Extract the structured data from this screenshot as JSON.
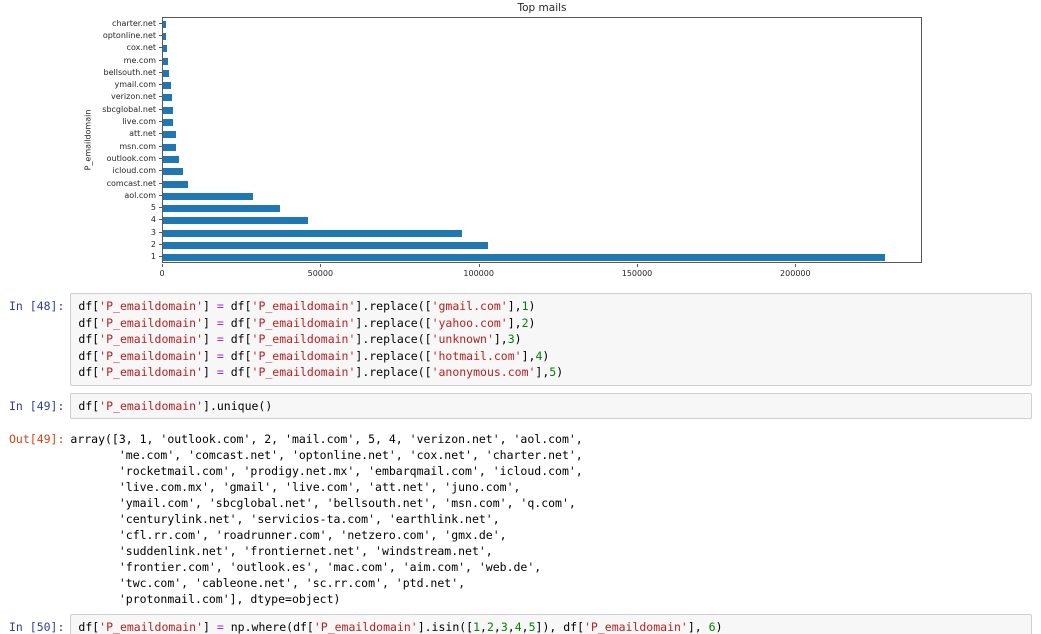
{
  "chart_data": {
    "type": "bar",
    "orientation": "horizontal",
    "title": "Top mails",
    "ylabel": "P_emaildomain",
    "xlabel": "",
    "categories": [
      "charter.net",
      "optonline.net",
      "cox.net",
      "me.com",
      "bellsouth.net",
      "ymail.com",
      "verizon.net",
      "sbcglobal.net",
      "live.com",
      "att.net",
      "msn.com",
      "outlook.com",
      "icloud.com",
      "comcast.net",
      "aol.com",
      "5",
      "4",
      "3",
      "2",
      "1"
    ],
    "values": [
      800,
      950,
      1400,
      1550,
      1900,
      2400,
      2700,
      3000,
      3050,
      4000,
      4100,
      5100,
      6300,
      7900,
      28300,
      37000,
      45700,
      94500,
      102500,
      228000
    ],
    "xlim": [
      0,
      240000
    ],
    "xticks": [
      0,
      50000,
      100000,
      150000,
      200000
    ],
    "bar_color": "#1f77b4",
    "grid": false,
    "legend": null
  },
  "notebook": {
    "cells": [
      {
        "kind": "code-input",
        "prompt": "In [48]:",
        "code_lines": [
          "df['P_emaildomain'] = df['P_emaildomain'].replace(['gmail.com'],1)",
          "df['P_emaildomain'] = df['P_emaildomain'].replace(['yahoo.com'],2)",
          "df['P_emaildomain'] = df['P_emaildomain'].replace(['unknown'],3)",
          "df['P_emaildomain'] = df['P_emaildomain'].replace(['hotmail.com'],4)",
          "df['P_emaildomain'] = df['P_emaildomain'].replace(['anonymous.com'],5)"
        ]
      },
      {
        "kind": "code-input",
        "prompt": "In [49]:",
        "code_lines": [
          "df['P_emaildomain'].unique()"
        ]
      },
      {
        "kind": "code-output",
        "prompt": "Out[49]:",
        "text_lines": [
          "array([3, 1, 'outlook.com', 2, 'mail.com', 5, 4, 'verizon.net', 'aol.com',",
          "       'me.com', 'comcast.net', 'optonline.net', 'cox.net', 'charter.net',",
          "       'rocketmail.com', 'prodigy.net.mx', 'embarqmail.com', 'icloud.com',",
          "       'live.com.mx', 'gmail', 'live.com', 'att.net', 'juno.com',",
          "       'ymail.com', 'sbcglobal.net', 'bellsouth.net', 'msn.com', 'q.com',",
          "       'centurylink.net', 'servicios-ta.com', 'earthlink.net',",
          "       'cfl.rr.com', 'roadrunner.com', 'netzero.com', 'gmx.de',",
          "       'suddenlink.net', 'frontiernet.net', 'windstream.net',",
          "       'frontier.com', 'outlook.es', 'mac.com', 'aim.com', 'web.de',",
          "       'twc.com', 'cableone.net', 'sc.rr.com', 'ptd.net',",
          "       'protonmail.com'], dtype=object)"
        ]
      },
      {
        "kind": "code-input",
        "prompt": "In [50]:",
        "code_lines": [
          "df['P_emaildomain'] = np.where(df['P_emaildomain'].isin([1,2,3,4,5]), df['P_emaildomain'], 6)"
        ]
      }
    ]
  },
  "colors": {
    "bar": "#1f77b4",
    "input_prompt": "#303F9F",
    "output_prompt": "#D84315",
    "string_token": "#BA2121",
    "number_token": "#008000",
    "operator_token": "#AA22FF",
    "cell_background": "#f7f7f7",
    "cell_border": "#cfcfcf",
    "axis_spine": "#595959"
  }
}
